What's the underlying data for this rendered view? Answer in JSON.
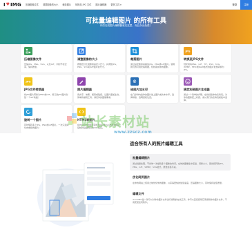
{
  "brand": {
    "logo_left": "I",
    "logo_right": "IMG"
  },
  "nav": {
    "items": [
      "压缩图像文件",
      "调整图像的大小",
      "裁剪图片",
      "转换至 JPG 文件",
      "图片编辑器",
      "更多工具 ▾"
    ],
    "login": "登录",
    "signup": "注册"
  },
  "hero": {
    "title": "可批量编辑图片 的所有工具",
    "subtitle": "你的在线图片编辑器就在这里，而且永远免费！"
  },
  "tools": [
    {
      "title": "压缩图像文件",
      "desc": "压缩JPG、PNG、SVG、以及GIF，同时节省空间，保持质量。",
      "icon": "compress-icon",
      "color": "#3a9e5b"
    },
    {
      "title": "调整图像的大小",
      "desc": "按照百分比或像素来定义尺寸，并调整JPG、PNG、SVG和GIF图片的尺寸。",
      "icon": "resize-icon",
      "color": "#2f7de1"
    },
    {
      "title": "裁剪图片",
      "desc": "通过设定像素来裁剪JPG、PNG或GIF图片。使用我们的可视化编辑器，轻松裁剪你的图像。",
      "icon": "crop-icon",
      "color": "#1d8fd8"
    },
    {
      "title": "转换至JPG文件",
      "desc": "轻松地将PNG、GIF、TIF、PSD、SVG、WEBP、HEIC或RAW格式的图片批量转换为JPG。",
      "icon": "to-jpg-icon",
      "color": "#f0a21f"
    },
    {
      "title": "JPG文件转换器",
      "desc": "将JPG图片转换为PNG或GIF，用几张JPG图片创建一个GIF动画！",
      "icon": "from-jpg-icon",
      "color": "#f0c419"
    },
    {
      "title": "照片编辑器",
      "desc": "用文字、效果、框架或贴纸，让图片更加生动。简单的编辑工具，满足你的图像需求。",
      "icon": "photo-editor-icon",
      "color": "#8e44ad"
    },
    {
      "title": "给图片加水印",
      "desc": "在几秒钟内给你的图片加上图片或文本水印。选择排版、透明度和位置。",
      "icon": "watermark-icon",
      "color": "#2a6fb5"
    },
    {
      "title": "搞笑別致图片生成器",
      "desc": "通过一个简单的步骤，在线创建你的表情包。为你的图像配上标题，或从流行的表情包模板中选择。",
      "icon": "meme-icon",
      "color": "#9b59b6"
    },
    {
      "title": "旋转一个图片",
      "desc": "同时旋转多个JPG、PNG或GIF图片。一次只选择纵向或横向图片！",
      "icon": "rotate-icon",
      "color": "#2f9fd8"
    },
    {
      "title": "HTML转图片",
      "desc": "将HTML中的网页转换为JPG或SVG格式的图片。复制并粘贴网页的URL链接。",
      "icon": "html-icon",
      "color": "#f0c419"
    }
  ],
  "watermark": {
    "text": "站长素材站",
    "url": "www.zzscz.com"
  },
  "feature": {
    "title": "适合所有人的照片编辑工具",
    "items": [
      {
        "heading": "批量编辑图片",
        "text": "通过批量处理，节省你一次编辑多个图像的时间。在你的图像集中压缩、调整大小、裁剪和转换JPG、PNG、GIF、WEBP、SVG格式，质量丝毫不减。"
      },
      {
        "heading": "优化网页图片",
        "text": "在你的网站上使用之前优化你的图像，以获得更快的加载速度。压缩图像大小，同时保持最佳质量。"
      },
      {
        "heading": "编辑文件",
        "text": "iLoveIMG是一款可以对你的图片文件进行编辑的在线工具，你可以直接使用它来编辑你的图片文件，不用安装任何软件。"
      }
    ]
  }
}
